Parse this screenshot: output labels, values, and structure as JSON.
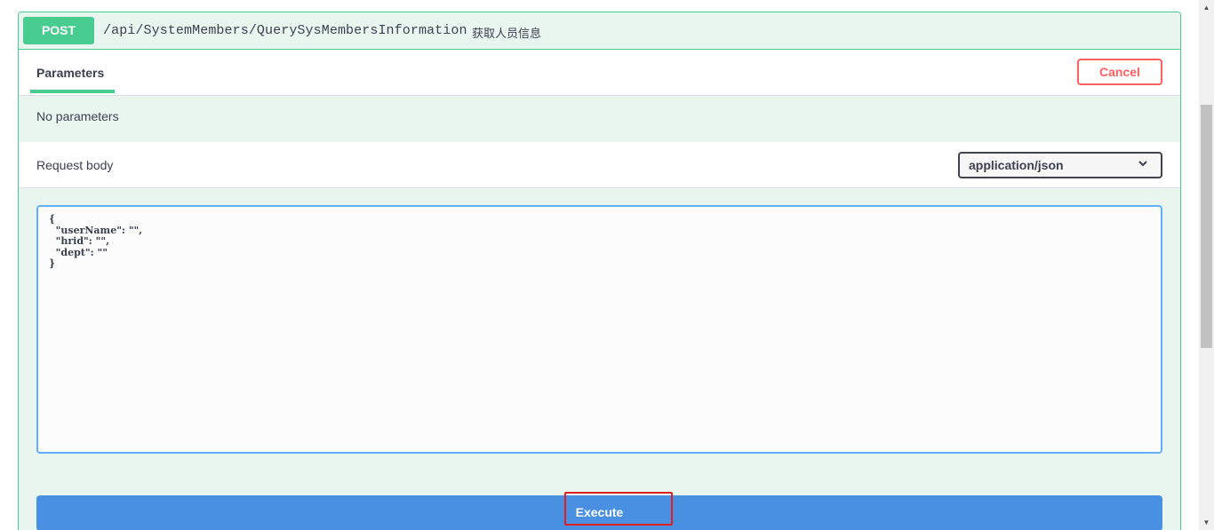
{
  "operation": {
    "method": "POST",
    "path": "/api/SystemMembers/QuerySysMembersInformation",
    "description": "获取人员信息"
  },
  "tabs": {
    "parameters_label": "Parameters",
    "cancel_label": "Cancel"
  },
  "parameters": {
    "empty_text": "No parameters"
  },
  "request_body": {
    "title": "Request body",
    "content_type": "application/json",
    "value": "{\n  \"userName\": \"\",\n  \"hrid\": \"\",\n  \"dept\": \"\"\n}"
  },
  "actions": {
    "execute_label": "Execute"
  },
  "colors": {
    "post_green": "#49cc90",
    "execute_blue": "#4990e2",
    "cancel_red": "#ff6060",
    "highlight_red": "#e02020"
  }
}
